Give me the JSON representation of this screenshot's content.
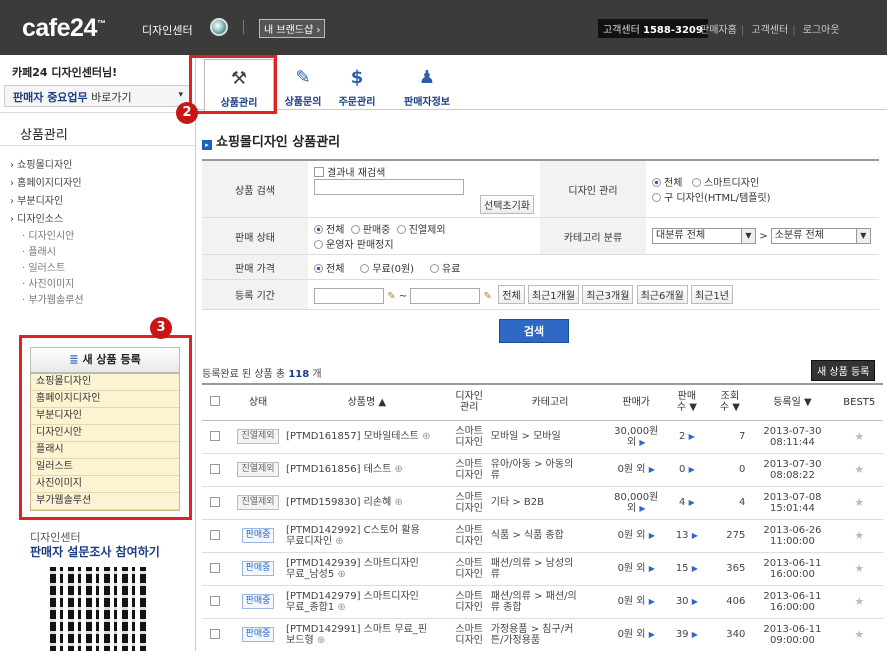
{
  "header": {
    "logo": "cafe24",
    "logo_tm": "™",
    "logo_sub": "디자인센터",
    "my_brand": "내 브랜드샵 ›",
    "cs_label": "고객센터",
    "cs_phone": "1588-3209",
    "links": [
      "판매자홈",
      "고객센터",
      "로그아웃"
    ]
  },
  "sidebar": {
    "greeting": "카페24 디자인센터님!",
    "work_select_bold": "판매자 중요업무",
    "work_select_rest": " 바로가기",
    "section_title": "상품관리",
    "menu": [
      {
        "label": "› 쇼핑몰디자인",
        "sub": false
      },
      {
        "label": "› 홈페이지디자인",
        "sub": false
      },
      {
        "label": "› 부분디자인",
        "sub": false
      },
      {
        "label": "› 디자인소스",
        "sub": false
      },
      {
        "label": "· 디자인시안",
        "sub": true
      },
      {
        "label": "· 플래시",
        "sub": true
      },
      {
        "label": "· 일러스트",
        "sub": true
      },
      {
        "label": "· 사진이미지",
        "sub": true
      },
      {
        "label": "· 부가웹솔루션",
        "sub": true
      }
    ],
    "new_product_btn": "새 상품 등록",
    "new_product_list": [
      "쇼핑몰디자인",
      "홈페이지디자인",
      "부분디자인",
      "디자인시안",
      "플래시",
      "일러스트",
      "사진이미지",
      "부가웹솔루션"
    ],
    "survey_line1": "디자인센터",
    "survey_line2": "판매자 설문조사 참여하기"
  },
  "badges": {
    "two": "2",
    "three": "3"
  },
  "tabs": [
    {
      "label": "상품관리",
      "icon": "product-icon",
      "active": true
    },
    {
      "label": "상품문의",
      "icon": "inquiry-icon",
      "active": false
    },
    {
      "label": "주문관리",
      "icon": "order-icon",
      "active": false
    },
    {
      "label": "판매자정보",
      "icon": "seller-info-icon",
      "active": false
    }
  ],
  "page_title": "쇼핑몰디자인 상품관리",
  "search": {
    "product_search_label": "상품 검색",
    "re_search": "결과내 재검색",
    "reset_btn": "선택초기화",
    "design_mgmt_label": "디자인 관리",
    "design_opts": [
      "전체",
      "스마트디자인",
      "구 디자인(HTML/템플릿)"
    ],
    "sale_status_label": "판매 상태",
    "sale_opts": [
      "전체",
      "판매중",
      "진열제외",
      "운영자 판매정지"
    ],
    "category_label": "카테고리 분류",
    "cat_large": "대분류 전체",
    "cat_small": "소분류 전체",
    "price_label": "판매 가격",
    "price_opts": [
      "전체",
      "무료(0원)",
      "유료"
    ],
    "date_label": "등록 기간",
    "date_tilde": "~",
    "date_btns": [
      "전체",
      "최근1개월",
      "최근3개월",
      "최근6개월",
      "최근1년"
    ],
    "search_btn": "검색"
  },
  "result": {
    "prefix": "등록완료 된 상품 총 ",
    "count": "118",
    "suffix": " 개",
    "new_btn": "새 상품 등록"
  },
  "table": {
    "headers": [
      "상태",
      "상품명 ▲",
      "디자인\n관리",
      "카테고리",
      "판매가",
      "판매\n수 ▼",
      "조회\n수 ▼",
      "등록일 ▼",
      "BEST5"
    ],
    "rows": [
      {
        "status": "진열제외",
        "name": "[PTMD161857] 모바일테스트",
        "design": "스마트\n디자인",
        "category": "모바일 > 모바일",
        "price": "30,000원\n외",
        "sales": "2",
        "views": "7",
        "date": "2013-07-30\n08:11:44"
      },
      {
        "status": "진열제외",
        "name": "[PTMD161856] 테스트",
        "design": "스마트\n디자인",
        "category": "유아/아동 > 아동의\n류",
        "price": "0원 외",
        "sales": "0",
        "views": "0",
        "date": "2013-07-30\n08:08:22"
      },
      {
        "status": "진열제외",
        "name": "[PTMD159830] 리손혜",
        "design": "스마트\n디자인",
        "category": "기타 > B2B",
        "price": "80,000원\n외",
        "sales": "4",
        "views": "4",
        "date": "2013-07-08\n15:01:44"
      },
      {
        "status": "판매중",
        "name": "[PTMD142992] C스토어 활용\n무료디자인",
        "design": "스마트\n디자인",
        "category": "식품 > 식품 종합",
        "price": "0원 외",
        "sales": "13",
        "views": "275",
        "date": "2013-06-26\n11:00:00"
      },
      {
        "status": "판매중",
        "name": "[PTMD142939] 스마트디자인\n무료_남성5",
        "design": "스마트\n디자인",
        "category": "패션/의류 > 남성의\n류",
        "price": "0원 외",
        "sales": "15",
        "views": "365",
        "date": "2013-06-11\n16:00:00"
      },
      {
        "status": "판매중",
        "name": "[PTMD142979] 스마트디자인\n무료_종합1",
        "design": "스마트\n디자인",
        "category": "패션/의류 > 패션/의\n류 종합",
        "price": "0원 외",
        "sales": "30",
        "views": "406",
        "date": "2013-06-11\n16:00:00"
      },
      {
        "status": "판매중",
        "name": "[PTMD142991] 스마트 무료_핀\n보드형",
        "design": "스마트\n디자인",
        "category": "가정용품 > 침구/커\n튼/가정용품",
        "price": "0원 외",
        "sales": "39",
        "views": "340",
        "date": "2013-06-11\n09:00:00"
      }
    ]
  }
}
